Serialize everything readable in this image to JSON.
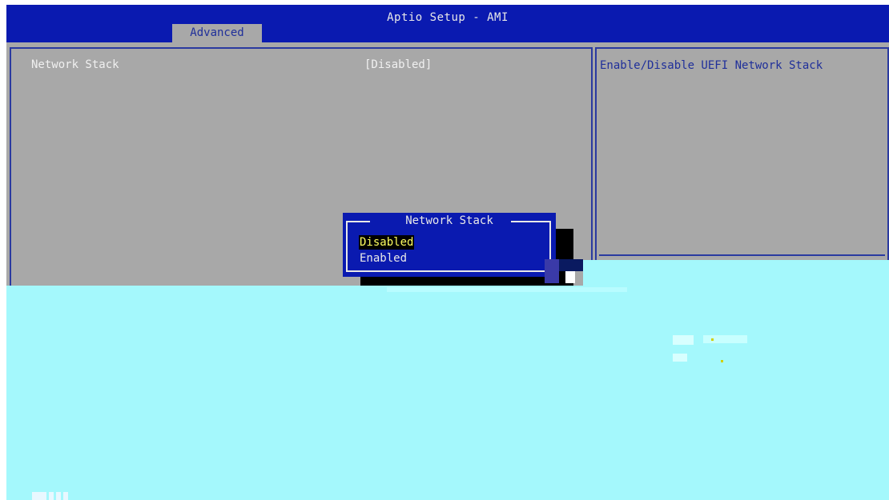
{
  "app": {
    "title": "Aptio Setup - AMI",
    "active_tab": "Advanced"
  },
  "settings": [
    {
      "label": "Network Stack",
      "value": "[Disabled]"
    }
  ],
  "help": {
    "text": "Enable/Disable UEFI Network Stack"
  },
  "popup": {
    "title": "Network Stack",
    "options": [
      {
        "label": "Disabled",
        "selected": true
      },
      {
        "label": "Enabled",
        "selected": false
      }
    ]
  },
  "colors": {
    "title_bar": "#0a1ab0",
    "panel_bg": "#a8a8a8",
    "frame_line": "#2a3aa0",
    "glitch_overlay": "#a4f8fc",
    "selected_option_text": "#ffff60"
  }
}
